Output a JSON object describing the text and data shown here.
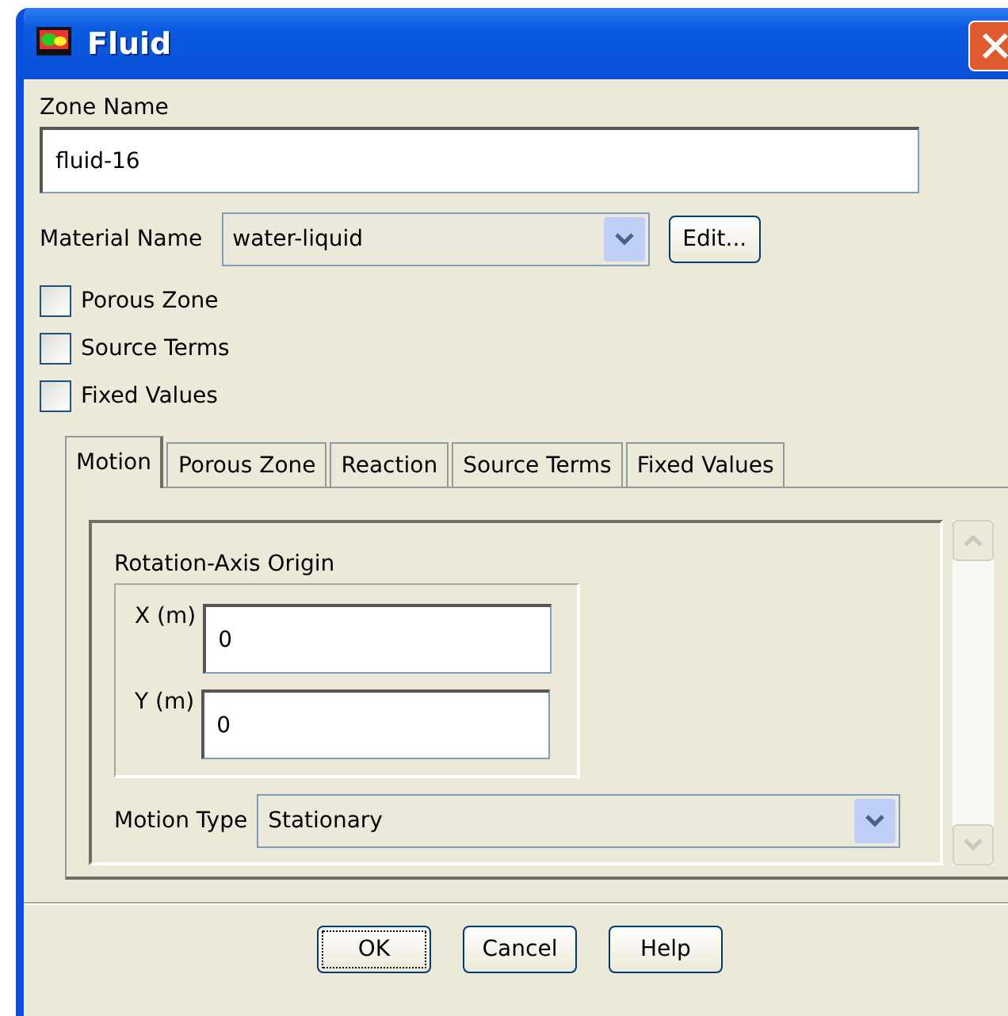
{
  "window": {
    "title": "Fluid"
  },
  "zone_name": {
    "label": "Zone Name",
    "value": "fluid-16"
  },
  "material": {
    "label": "Material Name",
    "value": "water-liquid",
    "edit_button": "Edit..."
  },
  "options": [
    {
      "label": "Porous Zone",
      "checked": false
    },
    {
      "label": "Source Terms",
      "checked": false
    },
    {
      "label": "Fixed Values",
      "checked": false
    }
  ],
  "tabs": [
    {
      "label": "Motion",
      "selected": true
    },
    {
      "label": "Porous Zone",
      "selected": false
    },
    {
      "label": "Reaction",
      "selected": false
    },
    {
      "label": "Source Terms",
      "selected": false
    },
    {
      "label": "Fixed Values",
      "selected": false
    }
  ],
  "motion": {
    "group_label": "Rotation-Axis Origin",
    "fields": [
      {
        "label": "X (m)",
        "value": "0"
      },
      {
        "label": "Y (m)",
        "value": "0"
      }
    ],
    "motion_type": {
      "label": "Motion Type",
      "value": "Stationary"
    }
  },
  "buttons": [
    {
      "label": "OK",
      "focused": true
    },
    {
      "label": "Cancel",
      "focused": false
    },
    {
      "label": "Help",
      "focused": false
    }
  ]
}
